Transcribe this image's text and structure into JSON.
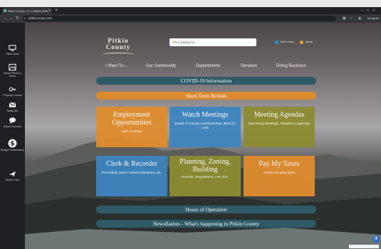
{
  "browser": {
    "tab_title": "Pitkin County, CO | Official Web...",
    "url": "pitkincounty.com",
    "incognito_label": "Incognito"
  },
  "sidebar": {
    "items": [
      {
        "icon": "computer-icon",
        "label": "Pitkin Voice"
      },
      {
        "icon": "photo-icon",
        "label": "Submit Photo to Home"
      },
      {
        "icon": "key-icon",
        "label": "Property Lookup"
      },
      {
        "icon": "envelope-icon",
        "label": "Notify Me"
      },
      {
        "icon": "chat-icon",
        "label": "Report Concern"
      },
      {
        "icon": "dollar-icon",
        "label": "Budget Performance"
      },
      {
        "icon": "plane-icon",
        "label": "Airport Cam"
      }
    ]
  },
  "header": {
    "logo_line1": "Pitkin",
    "logo_line2": "County",
    "search_placeholder": "I'm Looking For ...",
    "links": [
      {
        "label": "Web Cams",
        "color": "#1a9be0"
      },
      {
        "label": "Alerts",
        "color": "#e6a22c"
      }
    ]
  },
  "menu": [
    "I Want To...",
    "Our Community",
    "Departments",
    "Services",
    "Doing Business"
  ],
  "bars": {
    "covid": "COVID-19 Information",
    "short_term": "Short Term Rentals",
    "hours": "Hours of Operation",
    "newsflashes": "Newsflashes - What's happening in Pitkin County"
  },
  "tiles": [
    {
      "title": "Employment Opportunities",
      "subtitle": "Join our team",
      "color": "orange"
    },
    {
      "title": "Watch Meetings",
      "subtitle": "Board of County Commissioner (BOCC) LIVE",
      "color": "blue"
    },
    {
      "title": "Meeting Agendas",
      "subtitle": "Upcoming Meetings, Minutes & Agendas",
      "color": "olive"
    },
    {
      "title": "Clerk & Recorder",
      "subtitle": "Recording, Motor Vehicle Elections, etc.",
      "color": "blue"
    },
    {
      "title": "Planning, Zoning, Building",
      "subtitle": "Permits, Regulations, Fee Info.",
      "color": "olive"
    },
    {
      "title": "Pay My Taxes",
      "subtitle": "Online tax payments",
      "color": "orange"
    }
  ]
}
